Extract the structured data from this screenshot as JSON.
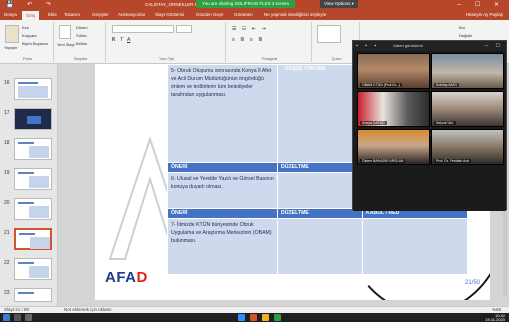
{
  "titlebar": {
    "document_title": "CALISTAY_ORNEKLER PROJE tamamı (GENEL) 2021.pptx - PowerPoint",
    "share_banner": "You are sharing SOLIFRASI FLES 3 screen",
    "view_options": "View Options ▾",
    "window_controls": "─ ☐ ✕",
    "quick_access": "💾 ↶ ↷"
  },
  "tabs": {
    "items": [
      "Dosya",
      "Giriş",
      "Ekle",
      "Tasarım",
      "Geçişler",
      "Animasyonlar",
      "Slayt Gösterisi",
      "Gözden Geçir",
      "Görünüm",
      "Ne yapmak istediğinizi söyleyin"
    ],
    "active": "Giriş",
    "right_tools": "Hüseyin Ay   Paylaş"
  },
  "ribbon": {
    "groups": [
      "Pano",
      "Slaytlar",
      "Yazı Tipi",
      "Paragraf",
      "Çizim",
      "Düzenleme"
    ],
    "paste": "Yapıştır",
    "cut": "Kes",
    "copy": "Kopyala",
    "format_painter": "Biçim Boyacısı",
    "new_slide": "Yeni Slayt",
    "layout": "Düzen",
    "reset": "Sıfırla",
    "section": "Bölüm",
    "find": "Bul",
    "replace": "Değiştir",
    "select": "Seç"
  },
  "thumbnails": {
    "items": [
      {
        "num": "16",
        "selected": false
      },
      {
        "num": "17",
        "selected": false
      },
      {
        "num": "18",
        "selected": false
      },
      {
        "num": "19",
        "selected": false
      },
      {
        "num": "20",
        "selected": false
      },
      {
        "num": "21",
        "selected": true
      },
      {
        "num": "22",
        "selected": false
      },
      {
        "num": "23",
        "selected": false
      }
    ]
  },
  "slide": {
    "top_fragment": "DÜŞÜŞ YÖNTEM",
    "columns": [
      "ÖNERİ",
      "DÜZELTME",
      "KABUL / RED"
    ],
    "rows": [
      {
        "oneri": "5- Obruk Oluşumu sonrasında Konya İl Afet ve Acil Durum Müdürlüğünün öngördüğü önlem ve tedbirlerin tüm belediyeler tarafından uygulanması.",
        "duzeltme": "",
        "kabul": ""
      },
      {
        "oneri": "6- Ulusal ve Yerelde Yazılı ve Görsel Basının konuya duyarlı olması.",
        "duzeltme": "",
        "kabul": ""
      },
      {
        "oneri": "7- İlimizde KTÜN bünyesinde Obruk Uygulama ve Araştırma Merkezinin (OBAM) bulunması.",
        "duzeltme": "",
        "kabul": ""
      }
    ],
    "logo_prefix": "AFA",
    "logo_suffix": "D",
    "page_number": "21/50"
  },
  "video_panel": {
    "title": "Galeri görünümü",
    "participants": [
      {
        "name": "OBAM KTÜN (Prof.Dr...)"
      },
      {
        "name": "Kubilay AKAY"
      },
      {
        "name": "Konya İl AFAD"
      },
      {
        "name": "Selçuk Üni."
      },
      {
        "name": "Özlem BAHADIR ARSLAN"
      },
      {
        "name": "Prof. Dr. Fetullah Arık"
      }
    ]
  },
  "statusbar": {
    "notes": "Not eklemek için tıklatın",
    "slide_info": "Slayt 21 / 50",
    "zoom": "%68"
  },
  "taskbar": {
    "time": "10:42",
    "date": "19.11.2020"
  },
  "colors": {
    "accent": "#b7472a",
    "table_header": "#4472c4",
    "table_body": "#cfd9ee",
    "afad_blue": "#1f3c88",
    "afad_red": "#e2231a"
  }
}
